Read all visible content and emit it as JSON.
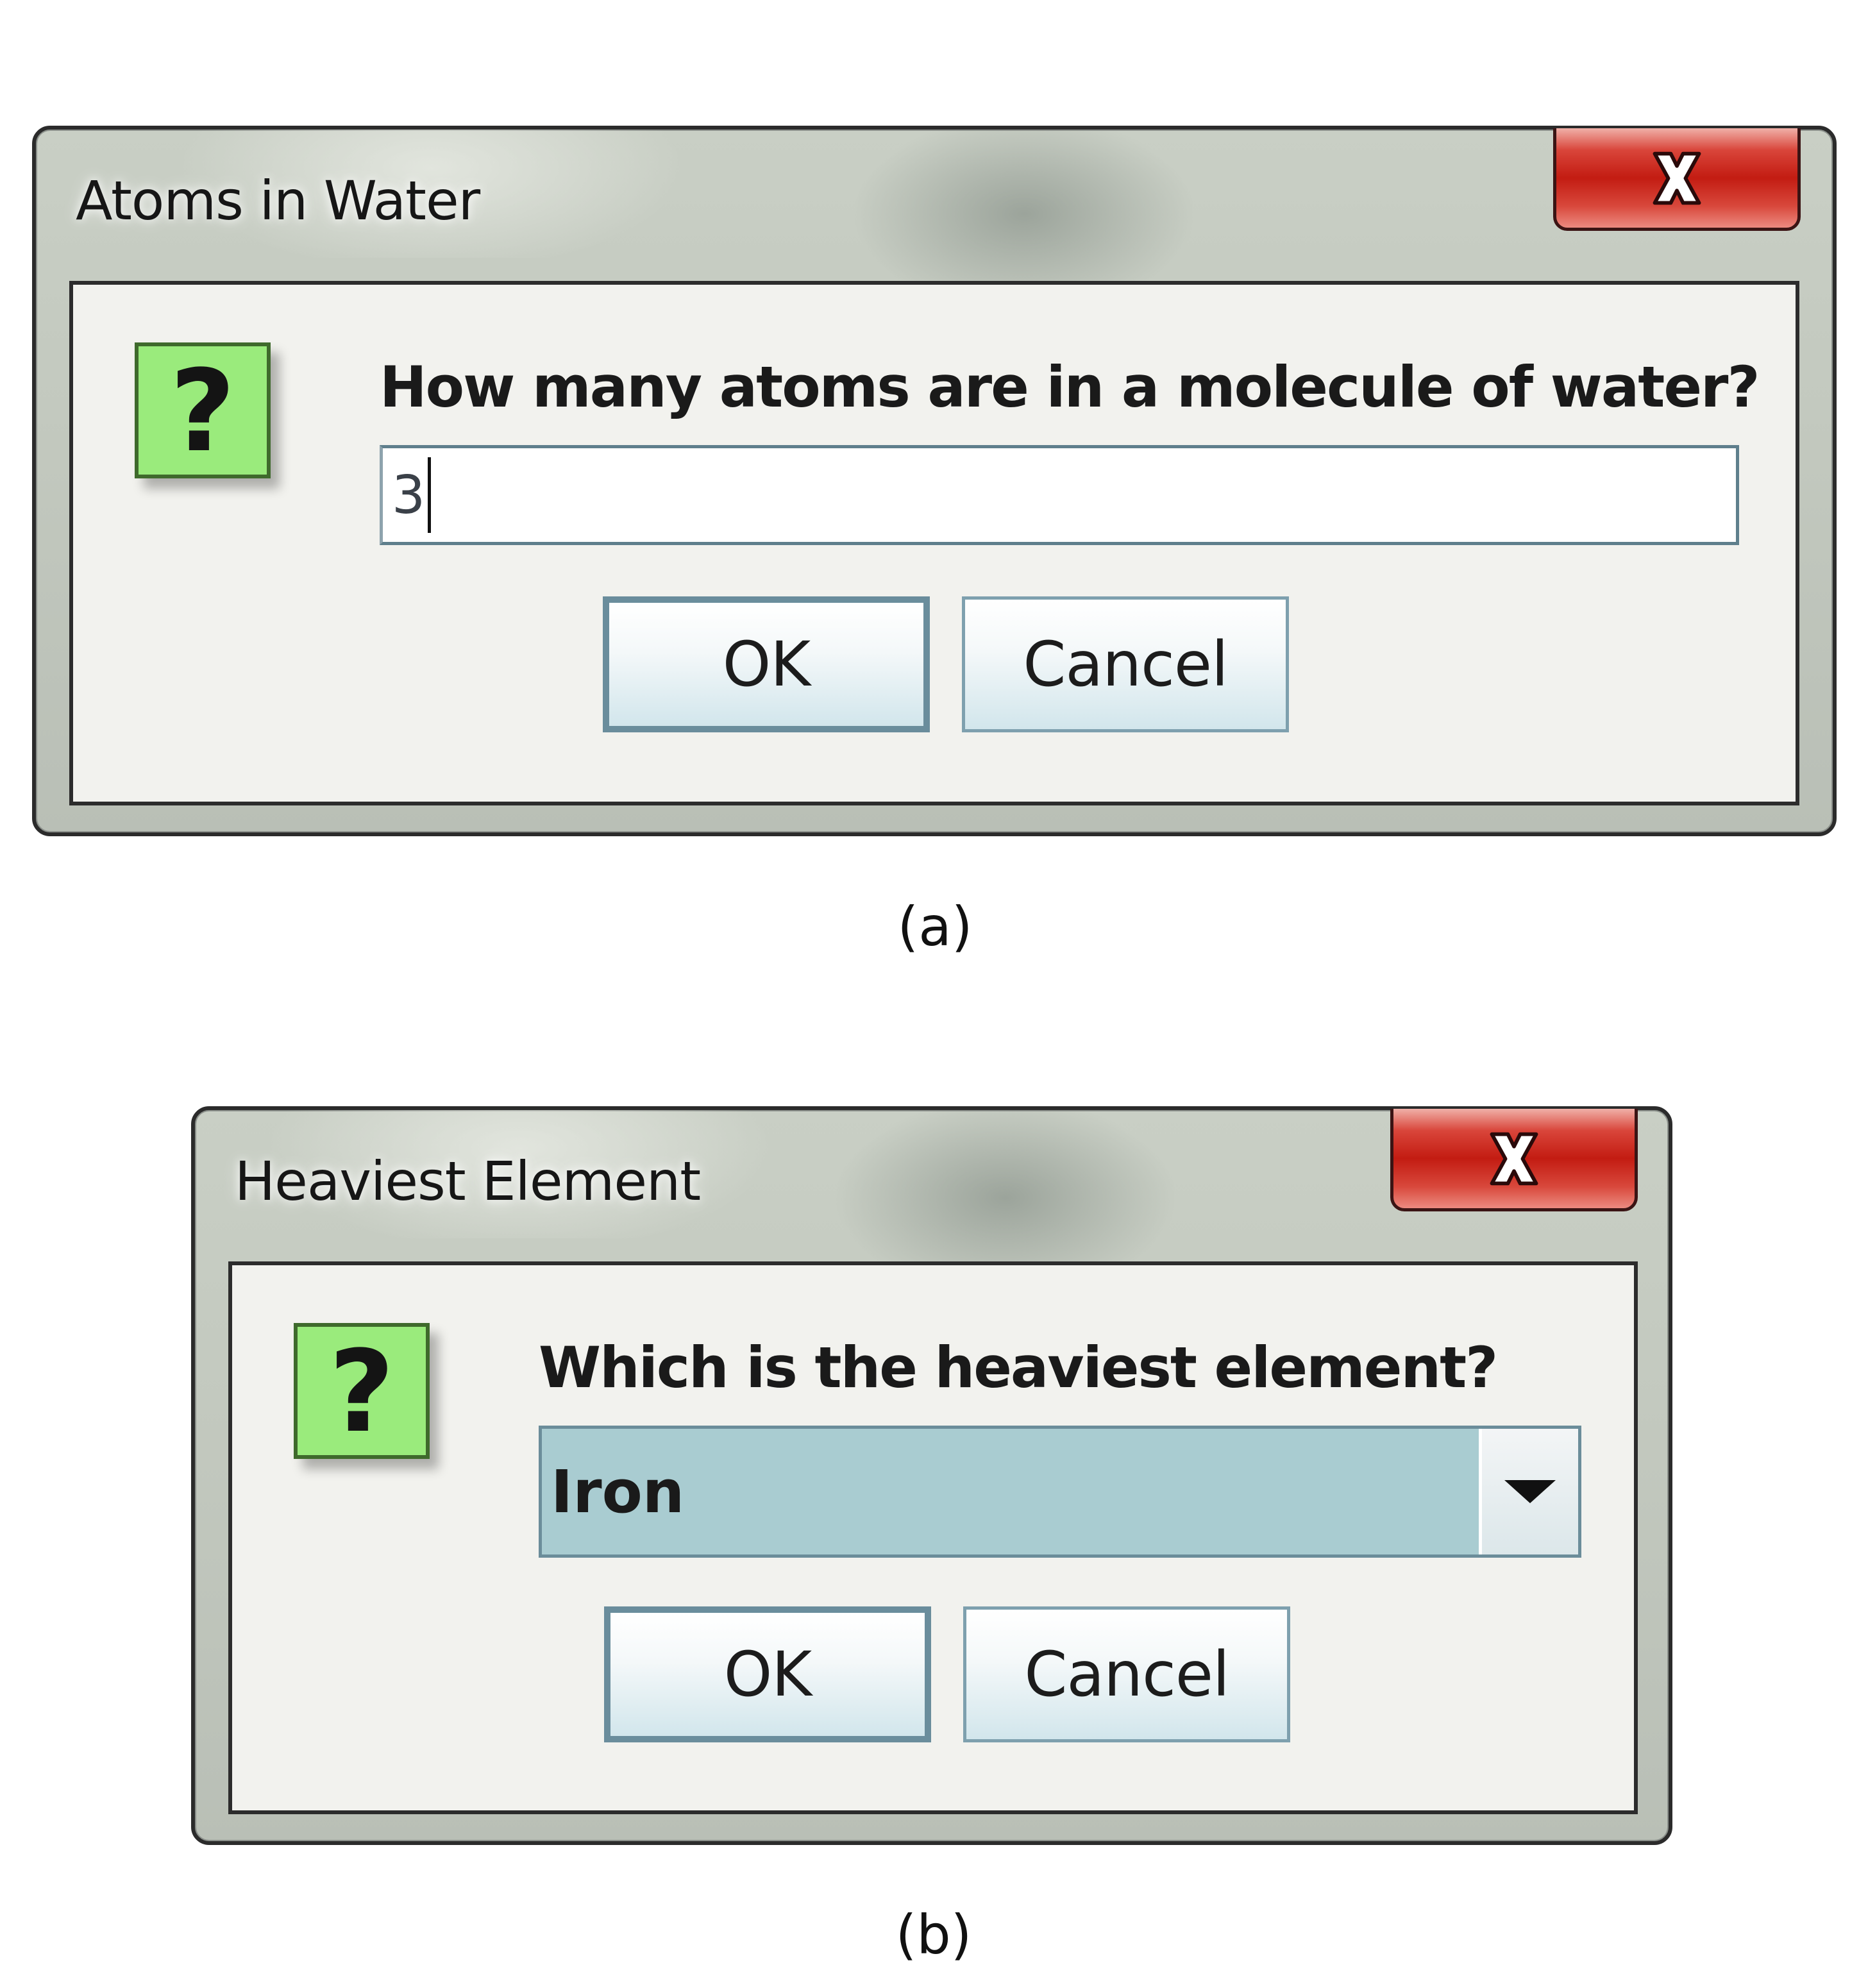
{
  "dialog_a": {
    "title": "Atoms in Water",
    "question": "How many atoms are in a molecule of water?",
    "input_value": "3",
    "ok_label": "OK",
    "cancel_label": "Cancel",
    "caption": "(a)"
  },
  "dialog_b": {
    "title": "Heaviest Element",
    "question": "Which is the heaviest element?",
    "selected_value": "Iron",
    "ok_label": "OK",
    "cancel_label": "Cancel",
    "caption": "(b)"
  },
  "icons": {
    "question_glyph": "?",
    "close": "close-icon",
    "question": "question-mark-icon",
    "dropdown": "chevron-down-icon"
  },
  "colors": {
    "close_button": "#c31c12",
    "question_icon_bg": "#9aeb7c",
    "combo_bg": "#a9ccd1",
    "button_border": "#6a8d9c"
  }
}
